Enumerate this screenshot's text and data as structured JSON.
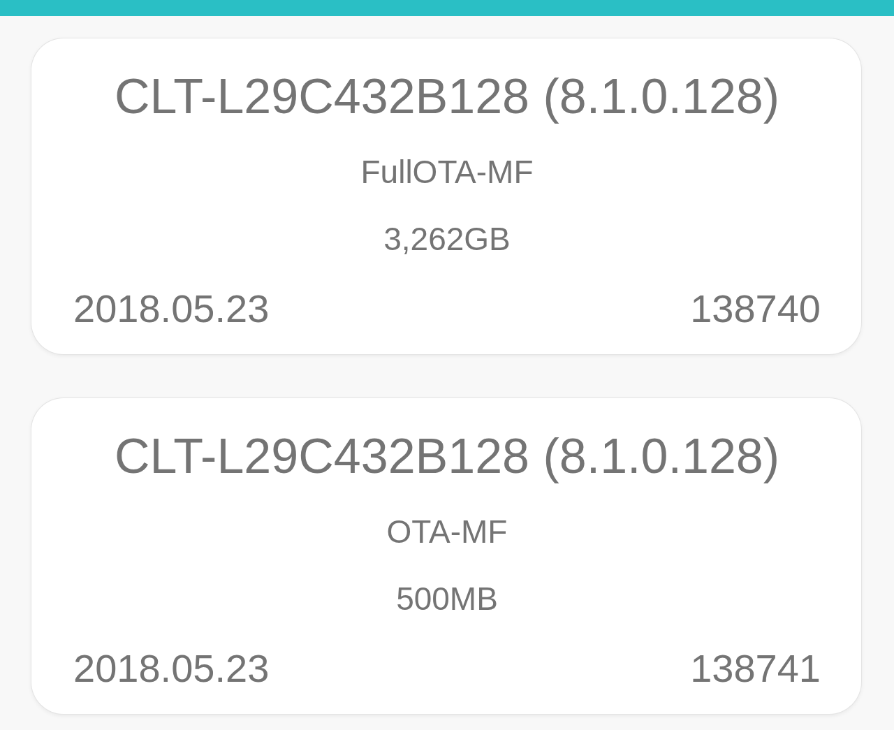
{
  "firmware_list": [
    {
      "title": "CLT-L29C432B128 (8.1.0.128)",
      "package_type": "FullOTA-MF",
      "size": "3,262GB",
      "date": "2018.05.23",
      "number": "138740"
    },
    {
      "title": "CLT-L29C432B128 (8.1.0.128)",
      "package_type": "OTA-MF",
      "size": "500MB",
      "date": "2018.05.23",
      "number": "138741"
    }
  ]
}
